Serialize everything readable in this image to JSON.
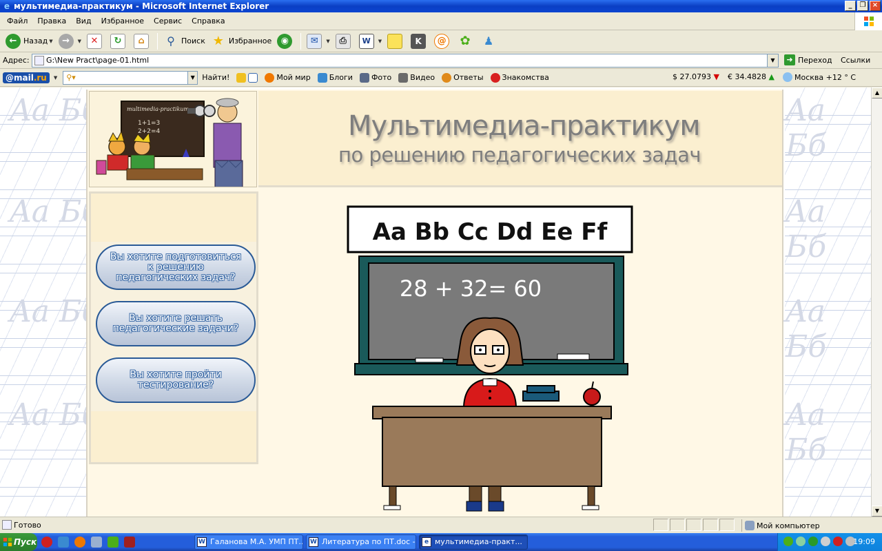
{
  "window": {
    "title": "мультимедиа-практикум - Microsoft Internet Explorer"
  },
  "menu": [
    "Файл",
    "Правка",
    "Вид",
    "Избранное",
    "Сервис",
    "Справка"
  ],
  "toolbar": {
    "back": "Назад",
    "search": "Поиск",
    "favorites": "Избранное"
  },
  "address": {
    "label": "Адрес:",
    "url": "G:\\New Pract\\page-01.html",
    "go": "Переход",
    "links": "Ссылки"
  },
  "mailru": {
    "logo_prefix": "@mail",
    "logo_suffix": ".ru",
    "find": "Найти!",
    "items": [
      "Мой мир",
      "Блоги",
      "Фото",
      "Видео",
      "Ответы",
      "Знакомства"
    ],
    "usd": "$ 27.0793",
    "eur": "€ 34.4828",
    "weather": "Москва +12 ° C"
  },
  "site": {
    "title_line1": "Мультимедиа-практикум",
    "title_line2": "по решению педагогических задач",
    "board_alphabet": "Aa Bb Cc Dd Ee Ff",
    "board_equation": "28 + 32= 60",
    "chalkboard_sign": "multimedia-practikum",
    "small_board_1": "1+1=3",
    "small_board_2": "2+2=4",
    "nav": [
      "Вы хотите подготовиться к решению педагогических задач?",
      "Вы хотите решать педагогические задачи?",
      "Вы хотите пройти тестирование?"
    ],
    "watermark": "Aa Бб"
  },
  "status": {
    "text": "Готово",
    "zone": "Мой компьютер"
  },
  "taskbar": {
    "start": "Пуск",
    "tasks": [
      "Галанова М.А. УМП ПТ....",
      "Литература по ПТ.doc -...",
      "мультимедиа-практ..."
    ],
    "clock": "19:09"
  }
}
